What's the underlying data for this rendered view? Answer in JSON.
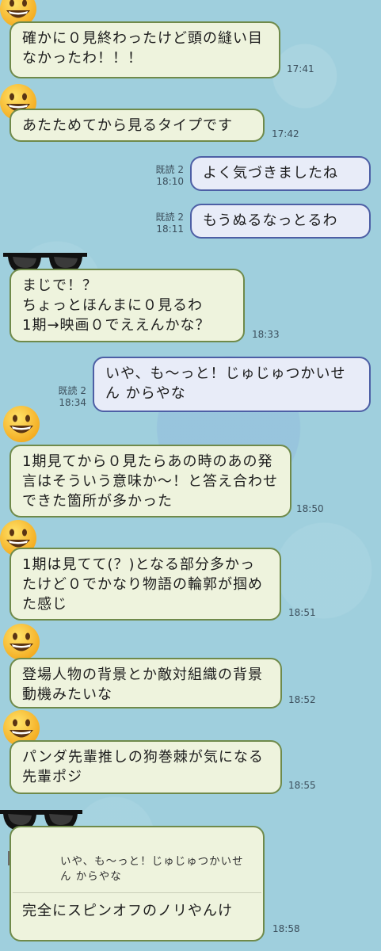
{
  "messages": [
    {
      "text": "確かに０見終わったけど頭の縫い目なかったわ！！！",
      "time": "17:41",
      "sender": "smiley"
    },
    {
      "text": "あたためてから見るタイプです",
      "time": "17:42",
      "sender": "smiley"
    },
    {
      "text": "よく気づきましたね",
      "time": "18:10",
      "read": "既読 2",
      "sender": "me"
    },
    {
      "text": "もうぬるなっとるわ",
      "time": "18:11",
      "read": "既読 2",
      "sender": "me"
    },
    {
      "lines": [
        "まじで！？",
        "ちょっとほんまに０見るわ",
        "1期→映画０でええんかな？"
      ],
      "time": "18:33",
      "sender": "sunglasses"
    },
    {
      "text": "いや、も〜っと！じゅじゅつかいせん からやな",
      "time": "18:34",
      "read": "既読 2",
      "sender": "me"
    },
    {
      "text": "1期見てから０見たらあの時のあの発言はそういう意味か〜！と答え合わせできた箇所が多かった",
      "time": "18:50",
      "sender": "smiley"
    },
    {
      "text": "1期は見てて(？)となる部分多かったけど０でかなり物語の輪郭が掴めた感じ",
      "time": "18:51",
      "sender": "smiley"
    },
    {
      "text": "登場人物の背景とか敵対組織の背景動機みたいな",
      "time": "18:52",
      "sender": "smiley"
    },
    {
      "text": "パンダ先輩推しの狗巻棘が気になる先輩ポジ",
      "time": "18:55",
      "sender": "smiley"
    },
    {
      "quote": "いや、も〜っと！じゅじゅつかいせん からやな",
      "text": "完全にスピンオフのノリやんけ",
      "time": "18:58",
      "sender": "sunglasses"
    }
  ],
  "icons": {
    "smiley": "grinning-face-icon",
    "sunglasses": "sunglasses-icon"
  },
  "colors": {
    "background": "#9fcfdd",
    "incoming_bubble": "#eef3dd",
    "outgoing_bubble": "#e8ecf8"
  }
}
